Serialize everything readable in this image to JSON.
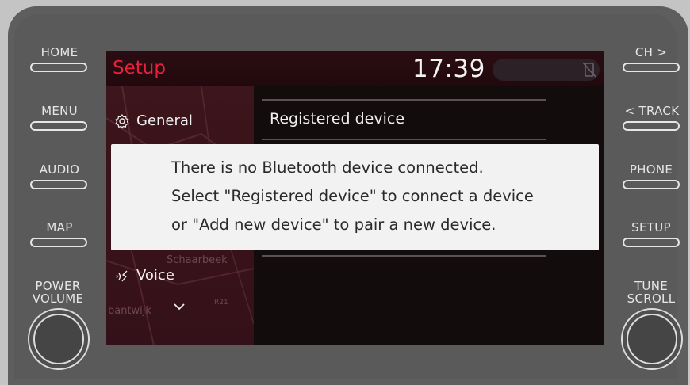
{
  "hardware_buttons": {
    "left": [
      {
        "label": "HOME"
      },
      {
        "label": "MENU"
      },
      {
        "label": "AUDIO"
      },
      {
        "label": "MAP"
      }
    ],
    "right": [
      {
        "label": "CH >"
      },
      {
        "label": "< TRACK"
      },
      {
        "label": "PHONE"
      },
      {
        "label": "SETUP"
      }
    ],
    "left_knob": {
      "line1": "POWER",
      "line2": "VOLUME"
    },
    "right_knob": {
      "line1": "TUNE",
      "line2": "SCROLL"
    }
  },
  "screen": {
    "title": "Setup",
    "clock": "17:39",
    "sidebar": {
      "items": [
        {
          "label": "General",
          "icon": "gear-icon"
        },
        {
          "label": "Voice",
          "icon": "voice-icon"
        }
      ],
      "map_labels": [
        "Schaarbeek",
        "R21",
        "bantwijk"
      ]
    },
    "main": {
      "items": [
        {
          "label": "Registered device"
        }
      ]
    },
    "dialog": {
      "lines": [
        "There is no Bluetooth device connected.",
        "Select \"Registered device\" to connect a device",
        "or \"Add new device\" to pair a new device."
      ]
    }
  },
  "colors": {
    "accent": "#e8213c",
    "bezel": "#5e5e5e",
    "screen_bg": "#120c0d",
    "dialog_bg": "#f2f2f2"
  }
}
